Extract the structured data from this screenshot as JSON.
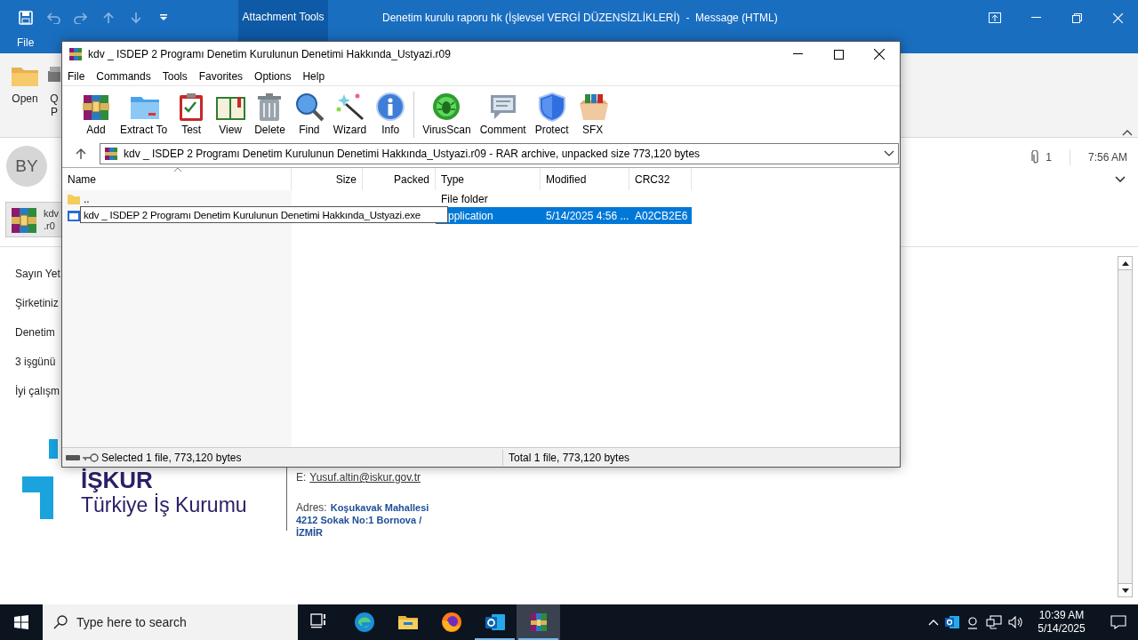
{
  "outlook": {
    "title": "Denetim kurulu raporu hk (İşlevsel VERGİ DÜZENSİZLİKLERİ)  -  Message (HTML)",
    "context_tab": "Attachment Tools",
    "tabs": [
      {
        "label": "File"
      }
    ],
    "ribbon_buttons": [
      {
        "label": "Open"
      },
      {
        "label": "Q",
        "label_line2": "P"
      }
    ],
    "sender_initials": "BY",
    "attachment": {
      "name": "kdv",
      "ext": ".r0"
    },
    "attachment_count": "1",
    "time": "7:56 AM",
    "body_lines": [
      "Sayın Yet",
      "Şirketiniz",
      "Denetim",
      "3 işgünü",
      "İyi çalışm"
    ],
    "logo": {
      "name": "İŞKUR",
      "subtitle": "Türkiye İş Kurumu"
    },
    "signature": {
      "email_label": "E:",
      "email": "Yusuf.altin@iskur.gov.tr",
      "address_label": "Adres:",
      "address_lines": [
        "Koşukavak Mahallesi",
        "4212 Sokak No:1 Bornova /",
        "İZMİR"
      ]
    }
  },
  "winrar": {
    "title": "kdv _ ISDEP 2 Programı Denetim Kurulunun Denetimi Hakkında_Ustyazi.r09",
    "menu": [
      "File",
      "Commands",
      "Tools",
      "Favorites",
      "Options",
      "Help"
    ],
    "toolbar": [
      {
        "label": "Add",
        "separator_before": false
      },
      {
        "label": "Extract To",
        "separator_before": false
      },
      {
        "label": "Test",
        "separator_before": false
      },
      {
        "label": "View",
        "separator_before": false
      },
      {
        "label": "Delete",
        "separator_before": false
      },
      {
        "label": "Find",
        "separator_before": false
      },
      {
        "label": "Wizard",
        "separator_before": false
      },
      {
        "label": "Info",
        "separator_before": false
      },
      {
        "label": "VirusScan",
        "separator_before": true
      },
      {
        "label": "Comment",
        "separator_before": false
      },
      {
        "label": "Protect",
        "separator_before": false
      },
      {
        "label": "SFX",
        "separator_before": false
      }
    ],
    "path": "kdv _ ISDEP 2 Programı Denetim Kurulunun Denetimi Hakkında_Ustyazi.r09 - RAR archive, unpacked size 773,120 bytes",
    "columns": [
      "Name",
      "Size",
      "Packed",
      "Type",
      "Modified",
      "CRC32"
    ],
    "rows": [
      {
        "kind": "folder",
        "name": "..",
        "type": "File folder",
        "selected": false
      },
      {
        "kind": "file",
        "rename_value": "kdv _ ISDEP 2 Programı Denetim Kurulunun Denetimi Hakkında_Ustyazi.exe",
        "type": "pplication",
        "modified": "5/14/2025 4:56 ...",
        "crc32": "A02CB2E6",
        "selected": true
      }
    ],
    "status_left": "Selected 1 file, 773,120 bytes",
    "status_right": "Total 1 file, 773,120 bytes"
  },
  "taskbar": {
    "search_placeholder": "Type here to search",
    "apps": [
      {
        "kind": "taskview",
        "running": false,
        "selected": false
      },
      {
        "kind": "edge",
        "running": false,
        "selected": false
      },
      {
        "kind": "explorer",
        "running": false,
        "selected": false
      },
      {
        "kind": "firefox",
        "running": false,
        "selected": false
      },
      {
        "kind": "outlook",
        "running": true,
        "selected": false
      },
      {
        "kind": "winrar",
        "running": true,
        "selected": true
      }
    ],
    "time": "10:39 AM",
    "date": "5/14/2025"
  }
}
